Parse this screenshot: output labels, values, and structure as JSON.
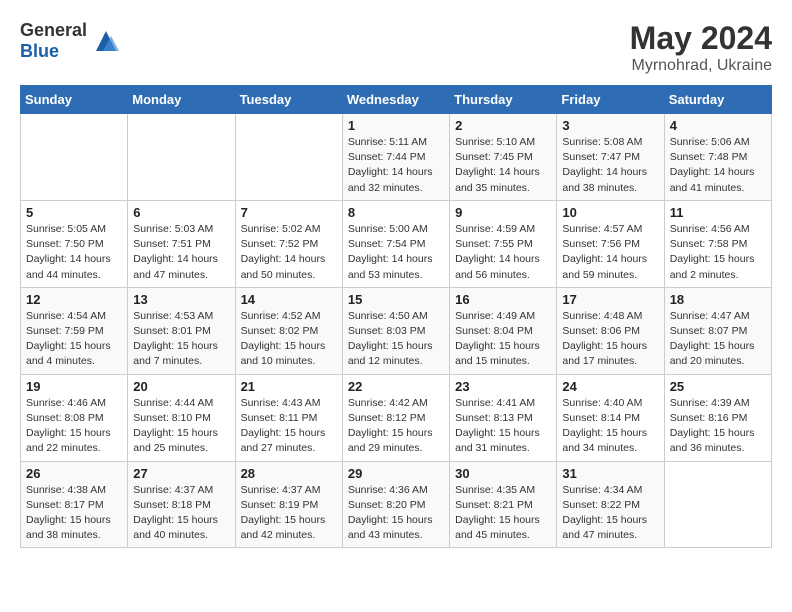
{
  "header": {
    "logo_general": "General",
    "logo_blue": "Blue",
    "month": "May 2024",
    "location": "Myrnohrad, Ukraine"
  },
  "weekdays": [
    "Sunday",
    "Monday",
    "Tuesday",
    "Wednesday",
    "Thursday",
    "Friday",
    "Saturday"
  ],
  "weeks": [
    [
      {
        "day": "",
        "info": ""
      },
      {
        "day": "",
        "info": ""
      },
      {
        "day": "",
        "info": ""
      },
      {
        "day": "1",
        "info": "Sunrise: 5:11 AM\nSunset: 7:44 PM\nDaylight: 14 hours\nand 32 minutes."
      },
      {
        "day": "2",
        "info": "Sunrise: 5:10 AM\nSunset: 7:45 PM\nDaylight: 14 hours\nand 35 minutes."
      },
      {
        "day": "3",
        "info": "Sunrise: 5:08 AM\nSunset: 7:47 PM\nDaylight: 14 hours\nand 38 minutes."
      },
      {
        "day": "4",
        "info": "Sunrise: 5:06 AM\nSunset: 7:48 PM\nDaylight: 14 hours\nand 41 minutes."
      }
    ],
    [
      {
        "day": "5",
        "info": "Sunrise: 5:05 AM\nSunset: 7:50 PM\nDaylight: 14 hours\nand 44 minutes."
      },
      {
        "day": "6",
        "info": "Sunrise: 5:03 AM\nSunset: 7:51 PM\nDaylight: 14 hours\nand 47 minutes."
      },
      {
        "day": "7",
        "info": "Sunrise: 5:02 AM\nSunset: 7:52 PM\nDaylight: 14 hours\nand 50 minutes."
      },
      {
        "day": "8",
        "info": "Sunrise: 5:00 AM\nSunset: 7:54 PM\nDaylight: 14 hours\nand 53 minutes."
      },
      {
        "day": "9",
        "info": "Sunrise: 4:59 AM\nSunset: 7:55 PM\nDaylight: 14 hours\nand 56 minutes."
      },
      {
        "day": "10",
        "info": "Sunrise: 4:57 AM\nSunset: 7:56 PM\nDaylight: 14 hours\nand 59 minutes."
      },
      {
        "day": "11",
        "info": "Sunrise: 4:56 AM\nSunset: 7:58 PM\nDaylight: 15 hours\nand 2 minutes."
      }
    ],
    [
      {
        "day": "12",
        "info": "Sunrise: 4:54 AM\nSunset: 7:59 PM\nDaylight: 15 hours\nand 4 minutes."
      },
      {
        "day": "13",
        "info": "Sunrise: 4:53 AM\nSunset: 8:01 PM\nDaylight: 15 hours\nand 7 minutes."
      },
      {
        "day": "14",
        "info": "Sunrise: 4:52 AM\nSunset: 8:02 PM\nDaylight: 15 hours\nand 10 minutes."
      },
      {
        "day": "15",
        "info": "Sunrise: 4:50 AM\nSunset: 8:03 PM\nDaylight: 15 hours\nand 12 minutes."
      },
      {
        "day": "16",
        "info": "Sunrise: 4:49 AM\nSunset: 8:04 PM\nDaylight: 15 hours\nand 15 minutes."
      },
      {
        "day": "17",
        "info": "Sunrise: 4:48 AM\nSunset: 8:06 PM\nDaylight: 15 hours\nand 17 minutes."
      },
      {
        "day": "18",
        "info": "Sunrise: 4:47 AM\nSunset: 8:07 PM\nDaylight: 15 hours\nand 20 minutes."
      }
    ],
    [
      {
        "day": "19",
        "info": "Sunrise: 4:46 AM\nSunset: 8:08 PM\nDaylight: 15 hours\nand 22 minutes."
      },
      {
        "day": "20",
        "info": "Sunrise: 4:44 AM\nSunset: 8:10 PM\nDaylight: 15 hours\nand 25 minutes."
      },
      {
        "day": "21",
        "info": "Sunrise: 4:43 AM\nSunset: 8:11 PM\nDaylight: 15 hours\nand 27 minutes."
      },
      {
        "day": "22",
        "info": "Sunrise: 4:42 AM\nSunset: 8:12 PM\nDaylight: 15 hours\nand 29 minutes."
      },
      {
        "day": "23",
        "info": "Sunrise: 4:41 AM\nSunset: 8:13 PM\nDaylight: 15 hours\nand 31 minutes."
      },
      {
        "day": "24",
        "info": "Sunrise: 4:40 AM\nSunset: 8:14 PM\nDaylight: 15 hours\nand 34 minutes."
      },
      {
        "day": "25",
        "info": "Sunrise: 4:39 AM\nSunset: 8:16 PM\nDaylight: 15 hours\nand 36 minutes."
      }
    ],
    [
      {
        "day": "26",
        "info": "Sunrise: 4:38 AM\nSunset: 8:17 PM\nDaylight: 15 hours\nand 38 minutes."
      },
      {
        "day": "27",
        "info": "Sunrise: 4:37 AM\nSunset: 8:18 PM\nDaylight: 15 hours\nand 40 minutes."
      },
      {
        "day": "28",
        "info": "Sunrise: 4:37 AM\nSunset: 8:19 PM\nDaylight: 15 hours\nand 42 minutes."
      },
      {
        "day": "29",
        "info": "Sunrise: 4:36 AM\nSunset: 8:20 PM\nDaylight: 15 hours\nand 43 minutes."
      },
      {
        "day": "30",
        "info": "Sunrise: 4:35 AM\nSunset: 8:21 PM\nDaylight: 15 hours\nand 45 minutes."
      },
      {
        "day": "31",
        "info": "Sunrise: 4:34 AM\nSunset: 8:22 PM\nDaylight: 15 hours\nand 47 minutes."
      },
      {
        "day": "",
        "info": ""
      }
    ]
  ]
}
